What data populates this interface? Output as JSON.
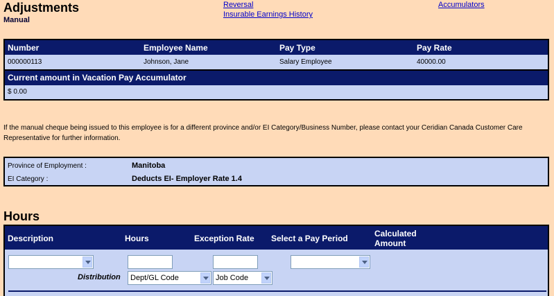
{
  "header": {
    "title": "Adjustments",
    "subtitle": "Manual",
    "links": {
      "reversal": "Reversal",
      "insurable_earnings_history": "Insurable Earnings History",
      "accumulators": "Accumulators"
    }
  },
  "employee_table": {
    "columns": [
      "Number",
      "Employee Name",
      "Pay Type",
      "Pay Rate"
    ],
    "row": [
      "000000113",
      "Johnson, Jane",
      "Salary Employee",
      "40000.00"
    ]
  },
  "accumulator": {
    "header": "Current amount in Vacation Pay Accumulator",
    "value": "$ 0.00"
  },
  "info_text": "If the manual cheque being issued to this employee is for a different province and/or EI Category/Business Number, please contact your Ceridian Canada Customer Care Representative for further information.",
  "province_panel": {
    "province_label": "Province of Employment :",
    "province_value": "Manitoba",
    "ei_label": "EI Category :",
    "ei_value": "Deducts EI- Employer Rate 1.4"
  },
  "hours": {
    "section_title": "Hours",
    "columns": {
      "description": "Description",
      "hours": "Hours",
      "exception_rate": "Exception Rate",
      "pay_period": "Select a Pay Period",
      "calculated_amount": "Calculated Amount"
    },
    "inputs": {
      "description_value": "",
      "hours_value": "",
      "exception_rate_value": "",
      "pay_period_value": ""
    },
    "distribution": {
      "label": "Distribution",
      "dept_value": "Dept/GL Code",
      "job_value": "Job Code"
    }
  }
}
